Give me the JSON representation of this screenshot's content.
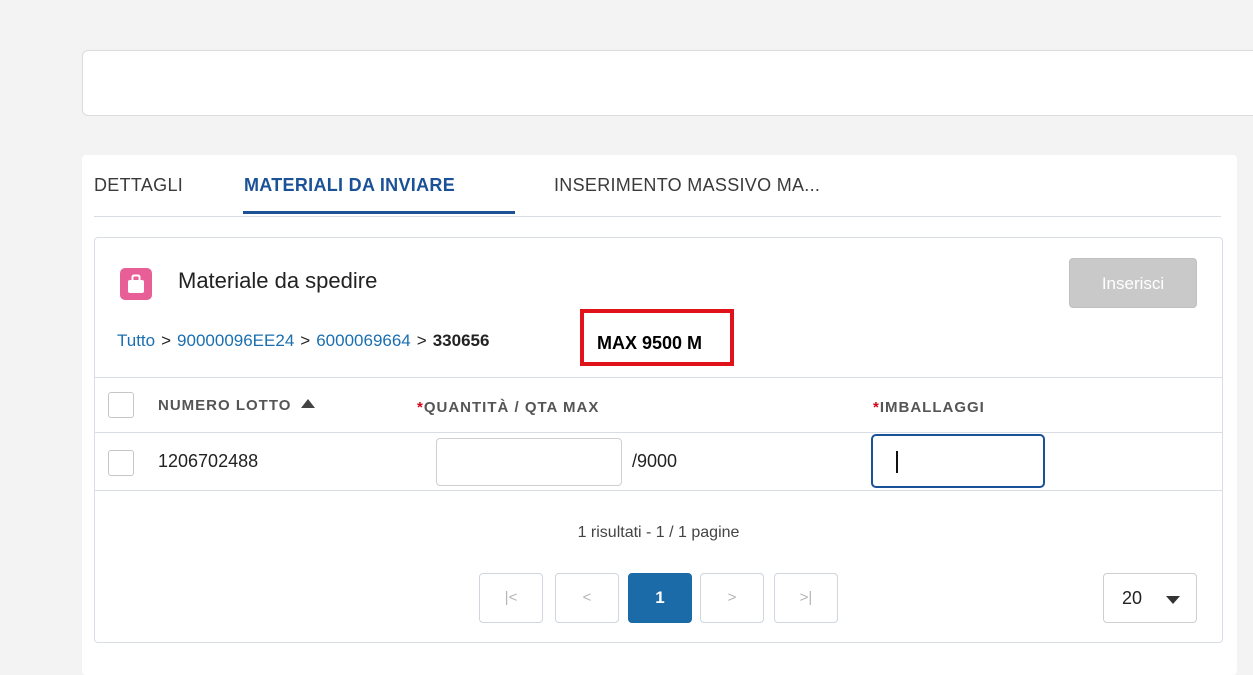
{
  "tabs": [
    {
      "label": "DETTAGLI",
      "active": false
    },
    {
      "label": "MATERIALI DA INVIARE",
      "active": true
    },
    {
      "label": "INSERIMENTO MASSIVO MA...",
      "active": false
    }
  ],
  "card": {
    "title": "Materiale da spedire",
    "icon": "briefcase-icon",
    "icon_color": "#e85e97",
    "insert_button": "Inserisci"
  },
  "breadcrumb": {
    "items": [
      "Tutto",
      "90000096EE24",
      "6000069664",
      "330656"
    ],
    "separator": ">",
    "highlight": "MAX 9500 M",
    "highlight_color": "#e0131a"
  },
  "table": {
    "headers": {
      "lotto": "NUMERO LOTTO",
      "quantita": "QUANTITÀ / QTA MAX",
      "imballaggi": "IMBALLAGGI",
      "required_mark": "*"
    },
    "rows": [
      {
        "lotto": "1206702488",
        "quantita_value": "",
        "qta_max": "/9000",
        "imballaggi_value": ""
      }
    ]
  },
  "pagination": {
    "summary": "1 risultati - 1 / 1 pagine",
    "first": "|<",
    "prev": "<",
    "current": "1",
    "next": ">",
    "last": ">|",
    "per_page": "20"
  },
  "colors": {
    "accent": "#1b5297",
    "link": "#1a6fb0",
    "current_page": "#1b6ba8"
  }
}
